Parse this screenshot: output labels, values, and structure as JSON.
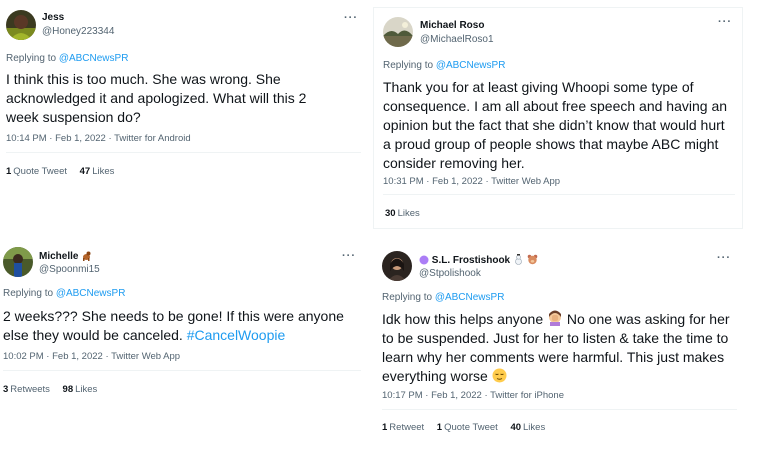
{
  "tweets": [
    {
      "name": "Jess",
      "handle": "@Honey223344",
      "more": "···",
      "replying_prefix": "Replying to ",
      "replying_to": "@ABCNewsPR",
      "text": "I think this is too much. She was wrong. She acknowledged it and apologized. What will this 2 week suspension do?",
      "timestamp": "10:14 PM · Feb 1, 2022 · Twitter for Android",
      "stats": {
        "quote_tweets_count": "1",
        "quote_tweets_label": "Quote Tweet",
        "likes_count": "47",
        "likes_label": "Likes"
      }
    },
    {
      "name": "Michael Roso",
      "handle": "@MichaelRoso1",
      "more": "···",
      "replying_prefix": "Replying to ",
      "replying_to": "@ABCNewsPR",
      "text": "Thank you for at least giving Whoopi some type of consequence. I am all about free speech and having an opinion but the fact that she didn’t know that would hurt a proud group of people shows that maybe ABC might consider removing her.",
      "timestamp": "10:31 PM · Feb 1, 2022 · Twitter Web App",
      "stats": {
        "likes_count": "30",
        "likes_label": "Likes"
      }
    },
    {
      "name": "Michelle",
      "handle": "@Spoonmi15",
      "more": "···",
      "replying_prefix": "Replying to ",
      "replying_to": "@ABCNewsPR",
      "text": "2 weeks??? She needs to be gone! If this were anyone else they would be canceled. ",
      "hashtag": "#CancelWoopie",
      "timestamp": "10:02 PM · Feb 1, 2022 · Twitter Web App",
      "stats": {
        "retweets_count": "3",
        "retweets_label": "Retweets",
        "likes_count": "98",
        "likes_label": "Likes"
      }
    },
    {
      "name": "S.L. Frostishook",
      "handle": "@Stpolishook",
      "more": "···",
      "replying_prefix": "Replying to ",
      "replying_to": "@ABCNewsPR",
      "text_part1": "Idk how this helps anyone",
      "text_part2": " No one was asking for her to be suspended. Just for her to listen & take the time to learn why her comments were harmful. This just makes everything worse",
      "timestamp": "10:17 PM · Feb 1, 2022 · Twitter for iPhone",
      "stats": {
        "retweets_count": "1",
        "retweets_label": "Retweet",
        "quote_tweets_count": "1",
        "quote_tweets_label": "Quote Tweet",
        "likes_count": "40",
        "likes_label": "Likes"
      }
    }
  ],
  "icons": {
    "more": "more-dots-icon",
    "dog_emoji": "dog-emoji-icon",
    "snowman_emoji": "snowman-emoji-icon",
    "bear_emoji": "bear-emoji-icon",
    "purple_circle": "purple-circle-icon",
    "facepalm_emoji": "facepalm-emoji-icon",
    "relieved_emoji": "relieved-emoji-icon"
  },
  "colors": {
    "link": "#1d9bf0",
    "secondary_text": "#536471",
    "primary_text": "#0f1419",
    "divider": "#eff3f4"
  }
}
